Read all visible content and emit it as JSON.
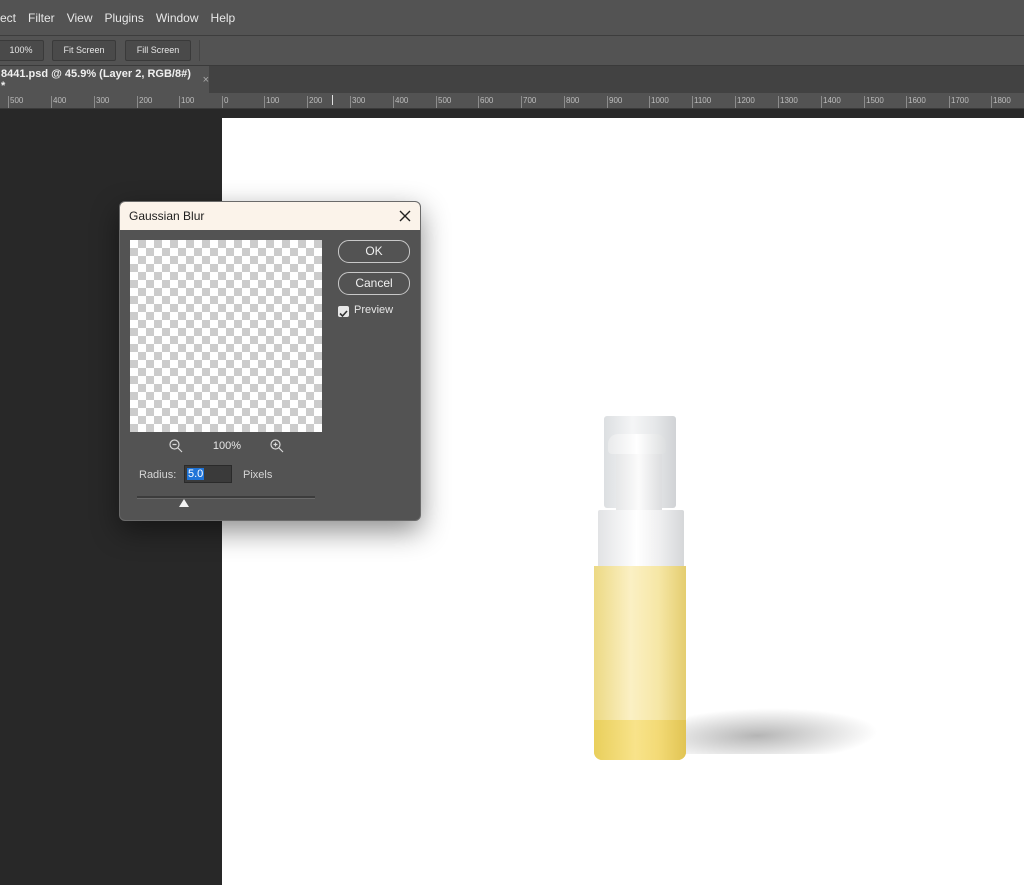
{
  "menubar": {
    "items": [
      "ect",
      "Filter",
      "View",
      "Plugins",
      "Window",
      "Help"
    ]
  },
  "options_bar": {
    "zoom_button": "100%",
    "fit_screen_button": "Fit Screen",
    "fill_screen_button": "Fill Screen"
  },
  "document_tab": {
    "title": "8441.psd @ 45.9% (Layer 2, RGB/8#) *",
    "close": "×"
  },
  "ruler": {
    "labels": [
      "500",
      "400",
      "300",
      "200",
      "100",
      "0",
      "100",
      "200",
      "300",
      "400",
      "500",
      "600",
      "700",
      "800",
      "900",
      "1000",
      "1100",
      "1200",
      "1300",
      "1400",
      "1500",
      "1600",
      "1700",
      "1800"
    ]
  },
  "dialog": {
    "title": "Gaussian Blur",
    "close_icon": "close-icon",
    "ok_label": "OK",
    "cancel_label": "Cancel",
    "preview_label": "Preview",
    "preview_checked": true,
    "zoom_level": "100%",
    "zoom_out_icon": "zoom-out-icon",
    "zoom_in_icon": "zoom-in-icon",
    "radius_label": "Radius:",
    "radius_value": "5.0",
    "radius_unit": "Pixels"
  },
  "colors": {
    "workspace": "#282828",
    "panel": "#535353",
    "dialog_title_bg": "#fbf3ea",
    "selection": "#1f74d8"
  }
}
